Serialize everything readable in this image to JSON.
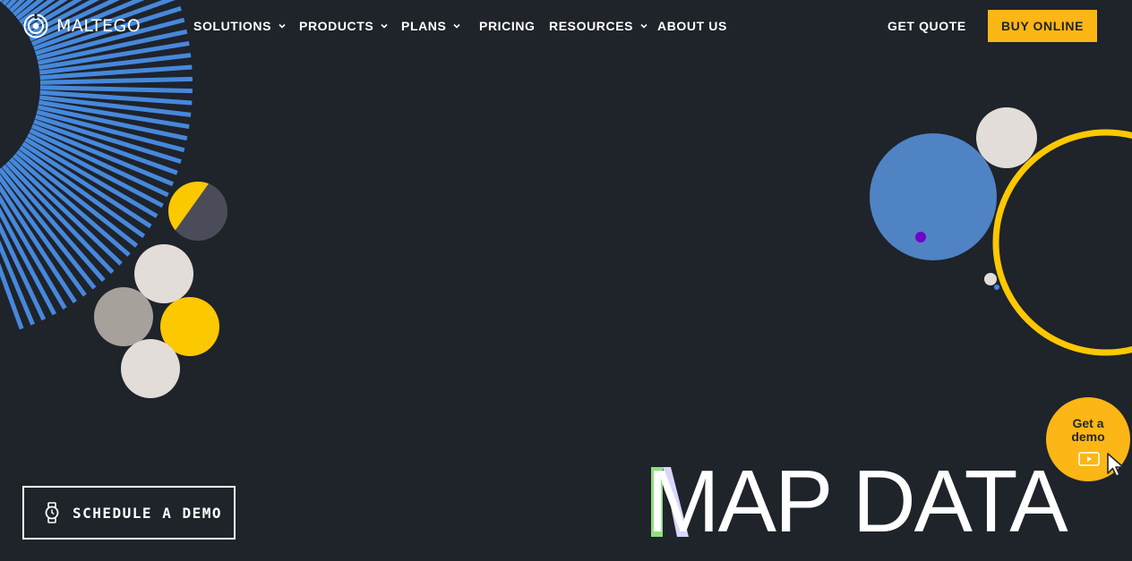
{
  "header": {
    "brand": "MALTEGO",
    "nav": [
      {
        "label": "SOLUTIONS",
        "dropdown": true
      },
      {
        "label": "PRODUCTS",
        "dropdown": true
      },
      {
        "label": "PLANS",
        "dropdown": true
      },
      {
        "label": "PRICING",
        "dropdown": false
      },
      {
        "label": "RESOURCES",
        "dropdown": true
      },
      {
        "label": "ABOUT US",
        "dropdown": false
      }
    ],
    "get_quote": "GET QUOTE",
    "buy_online": "BUY ONLINE"
  },
  "hero": {
    "headline": "MAP DATA",
    "schedule_demo": "SCHEDULE A DEMO",
    "demo_bubble": [
      "Get a",
      "demo"
    ]
  },
  "colors": {
    "background": "#1f232a",
    "accent_yellow": "#fcb615",
    "accent_blue": "#4f83c4",
    "ray_blue": "#4688dc",
    "light_gray": "#e2ddd9",
    "warm_gray": "#a7a19c",
    "purple_dot": "#7000c8",
    "accent_green": "#8ee07f"
  },
  "icons": [
    "maltego-logo-icon",
    "chevron-down-icon",
    "stopwatch-icon",
    "play-icon",
    "cursor-arrow-icon"
  ]
}
